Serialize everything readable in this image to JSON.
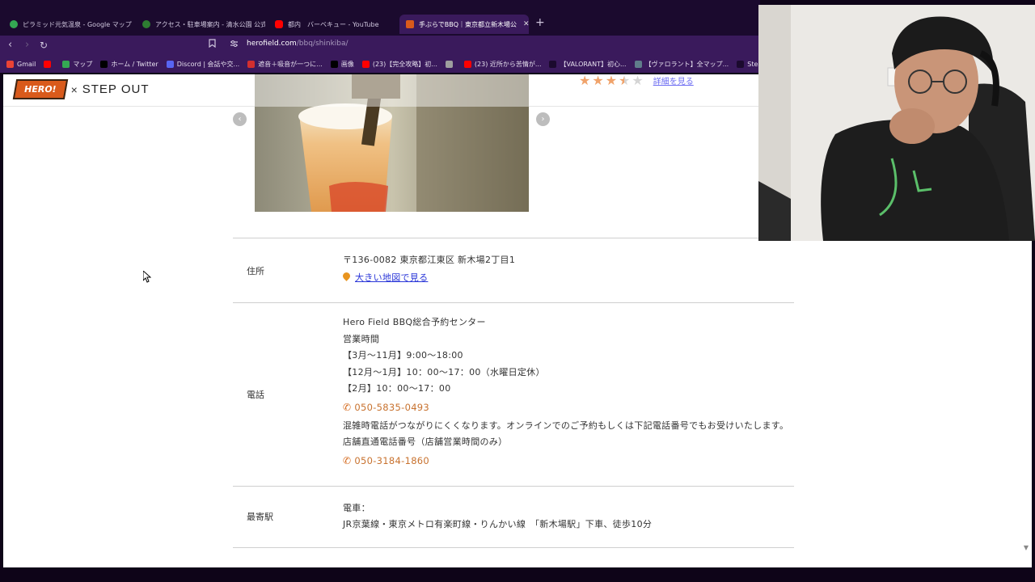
{
  "tabs": [
    {
      "label": "ピラミッド元気温泉 - Google マップ",
      "color": "#34a853"
    },
    {
      "label": "アクセス・駐車場案内 - 清水公園 公式",
      "color": "#2e7d32"
    },
    {
      "label": "都内　バーベキュー - YouTube",
      "color": "#ff0000"
    },
    {
      "label": "手ぶらでBBQ｜東京都立新木場公",
      "color": "#d95a1b"
    }
  ],
  "close_tab_glyph": "✕",
  "new_tab_glyph": "+",
  "nav": {
    "back": "‹",
    "forward": "›",
    "reload": "↻"
  },
  "address_bar": {
    "host": "herofield.com",
    "path": "/bbq/shinkiba/"
  },
  "bookmarks": [
    {
      "label": "Gmail",
      "icon": "gmail-icon",
      "color": "#ea4335"
    },
    {
      "label": "",
      "icon": "youtube-icon",
      "color": "#ff0000"
    },
    {
      "label": "マップ",
      "icon": "maps-icon",
      "color": "#34a853"
    },
    {
      "label": "ホーム / Twitter",
      "icon": "x-icon",
      "color": "#000000"
    },
    {
      "label": "Discord | 会話や交...",
      "icon": "discord-icon",
      "color": "#5865f2"
    },
    {
      "label": "遮音＋吸音が一つに...",
      "icon": "shop-icon",
      "color": "#d32f2f"
    },
    {
      "label": "画像",
      "icon": "x-icon",
      "color": "#000000"
    },
    {
      "label": "(23)【完全攻略】初...",
      "icon": "youtube-icon",
      "color": "#ff0000"
    },
    {
      "label": "",
      "icon": "globe-icon",
      "color": "#9e9e9e"
    },
    {
      "label": "(23) 近所から苦情が...",
      "icon": "youtube-icon",
      "color": "#ff0000"
    },
    {
      "label": "【VALORANT】初心...",
      "icon": "page-icon",
      "color": "#1b0a2e"
    },
    {
      "label": "【ヴァロラント】全マップ...",
      "icon": "page-icon",
      "color": "#607d8b"
    },
    {
      "label": "SteamDB",
      "icon": "steamdb-icon",
      "color": "#1b0a2e"
    }
  ],
  "site": {
    "logo_hero": "HERO!",
    "logo_x": "×",
    "logo_step": "STEP OUT",
    "rating_link": "詳細を見る",
    "rating_value": 3.5,
    "slider_prev": "‹",
    "slider_next": "›"
  },
  "info": {
    "address": {
      "label": "住所",
      "postal": "〒136-0082 東京都江東区 新木場2丁目1",
      "map_link": "大きい地図で見る"
    },
    "tel": {
      "label": "電話",
      "center": "Hero Field BBQ総合予約センター",
      "hours_title": "営業時間",
      "hours_1": "【3月～11月】9:00～18:00",
      "hours_2": "【12月～1月】10：00～17：00（水曜日定休）",
      "hours_3": "【2月】10：00～17：00",
      "phone_1": "050-5835-0493",
      "note": "混雑時電話がつながりにくくなります。オンラインでのご予約もしくは下記電話番号でもお受けいたします。",
      "direct_title": "店舗直通電話番号（店舗営業時間のみ）",
      "phone_2": "050-3184-1860"
    },
    "station": {
      "label": "最寄駅",
      "line_1": "電車：",
      "line_2": "JR京葉線・東京メトロ有楽町線・りんかい線　「新木場駅」下車、徒歩10分"
    }
  }
}
